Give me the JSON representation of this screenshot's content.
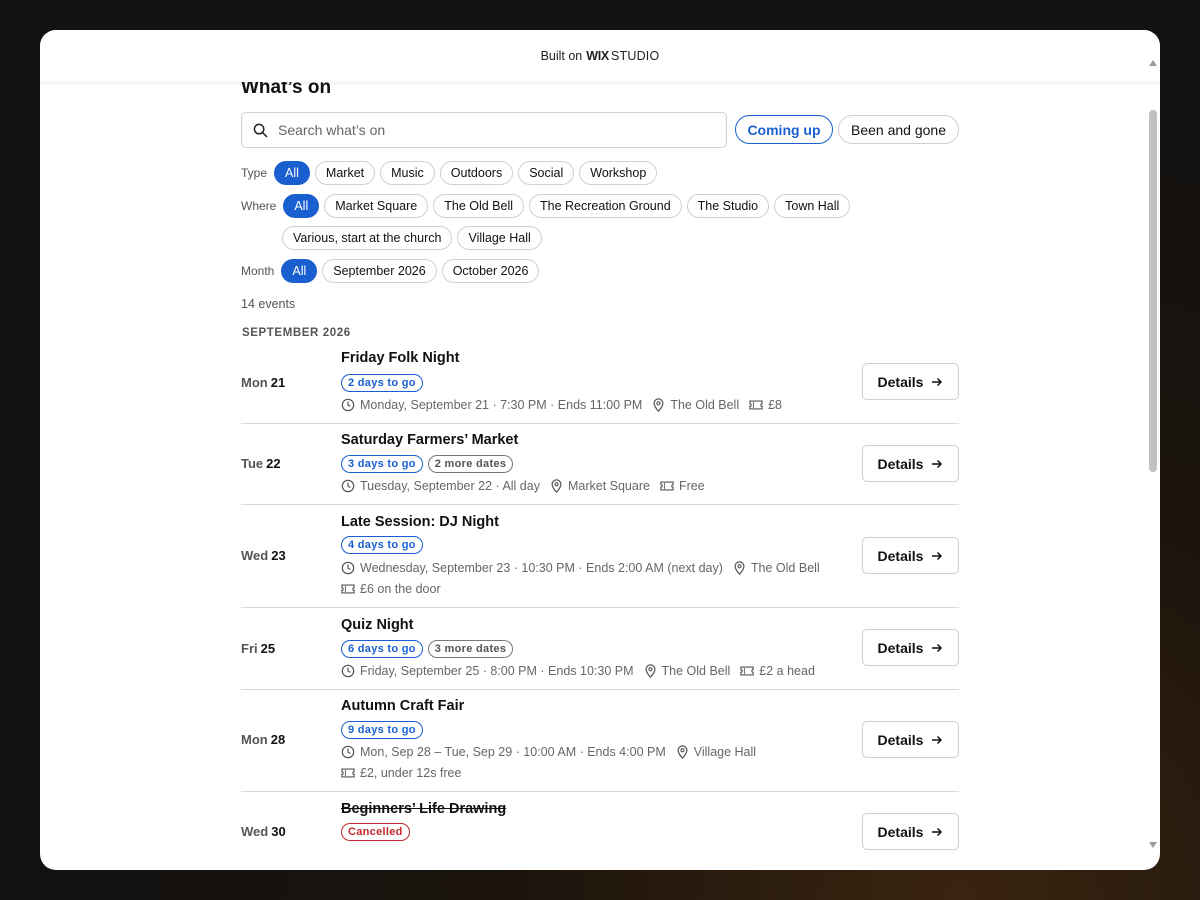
{
  "topbar": {
    "built_on": "Built on",
    "wix": "WIX",
    "studio": "STUDIO"
  },
  "page": {
    "title": "What’s on"
  },
  "search": {
    "placeholder": "Search what’s on",
    "value": ""
  },
  "toggle": {
    "coming_up": "Coming up",
    "been_and_gone": "Been and gone",
    "active": "Coming up"
  },
  "filters": {
    "type": {
      "label": "Type",
      "options": [
        "All",
        "Market",
        "Music",
        "Outdoors",
        "Social",
        "Workshop"
      ],
      "selected": "All"
    },
    "where": {
      "label": "Where",
      "options": [
        "All",
        "Market Square",
        "The Old Bell",
        "The Recreation Ground",
        "The Studio",
        "Town Hall",
        "Various, start at the church",
        "Village Hall"
      ],
      "selected": "All"
    },
    "month": {
      "label": "Month",
      "options": [
        "All",
        "September 2026",
        "October 2026"
      ],
      "selected": "All"
    }
  },
  "count": "14 events",
  "month_header": "SEPTEMBER 2026",
  "details_label": "Details",
  "events": [
    {
      "dow": "Mon",
      "day": "21",
      "title": "Friday Folk Night",
      "badges": [
        {
          "text": "2 days to go",
          "kind": "blue"
        }
      ],
      "when": "Monday, September 21 · 7:30 PM · Ends 11:00 PM",
      "where": "The Old Bell",
      "price": "£8"
    },
    {
      "dow": "Tue",
      "day": "22",
      "title": "Saturday Farmers’ Market",
      "badges": [
        {
          "text": "3 days to go",
          "kind": "blue"
        },
        {
          "text": "2 more dates",
          "kind": "gray"
        }
      ],
      "when": "Tuesday, September 22 · All day",
      "where": "Market Square",
      "price": "Free"
    },
    {
      "dow": "Wed",
      "day": "23",
      "title": "Late Session: DJ Night",
      "badges": [
        {
          "text": "4 days to go",
          "kind": "blue"
        }
      ],
      "when": "Wednesday, September 23 · 10:30 PM · Ends 2:00 AM (next day)",
      "where": "The Old Bell",
      "price": "£6 on the door"
    },
    {
      "dow": "Fri",
      "day": "25",
      "title": "Quiz Night",
      "badges": [
        {
          "text": "6 days to go",
          "kind": "blue"
        },
        {
          "text": "3 more dates",
          "kind": "gray"
        }
      ],
      "when": "Friday, September 25 · 8:00 PM · Ends 10:30 PM",
      "where": "The Old Bell",
      "price": "£2 a head"
    },
    {
      "dow": "Mon",
      "day": "28",
      "title": "Autumn Craft Fair",
      "badges": [
        {
          "text": "9 days to go",
          "kind": "blue"
        }
      ],
      "when": "Mon, Sep 28 – Tue, Sep 29 · 10:00 AM · Ends 4:00 PM",
      "where": "Village Hall",
      "price": "£2, under 12s free"
    },
    {
      "dow": "Wed",
      "day": "30",
      "title": "Beginners’ Life Drawing",
      "badges": [
        {
          "text": "Cancelled",
          "kind": "red"
        }
      ]
    }
  ],
  "colors": {
    "accent": "#1a5fd0",
    "cancel": "#c0282d",
    "border": "#d0d0d0"
  }
}
